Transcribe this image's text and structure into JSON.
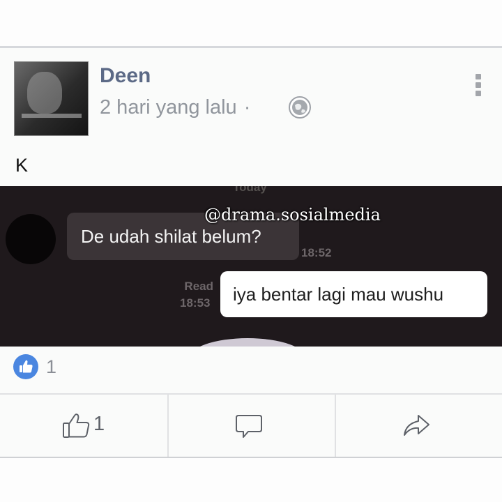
{
  "post": {
    "author": "Deen",
    "time": "2 hari yang lalu",
    "separator": "·",
    "text": "K"
  },
  "chat": {
    "date_label": "Today",
    "incoming_message": "De udah shilat belum?",
    "incoming_time": "18:52",
    "outgoing_message": "iya bentar lagi mau wushu",
    "read_status": "Read",
    "outgoing_time": "18:53"
  },
  "watermark": "@drama.sosialmedia",
  "reactions": {
    "count": "1",
    "icon": "like-reaction-icon"
  },
  "actions": {
    "like_count": "1"
  },
  "colors": {
    "author": "#5c6a86",
    "like_blue": "#4a86e0",
    "chat_background": "#1f191c"
  }
}
